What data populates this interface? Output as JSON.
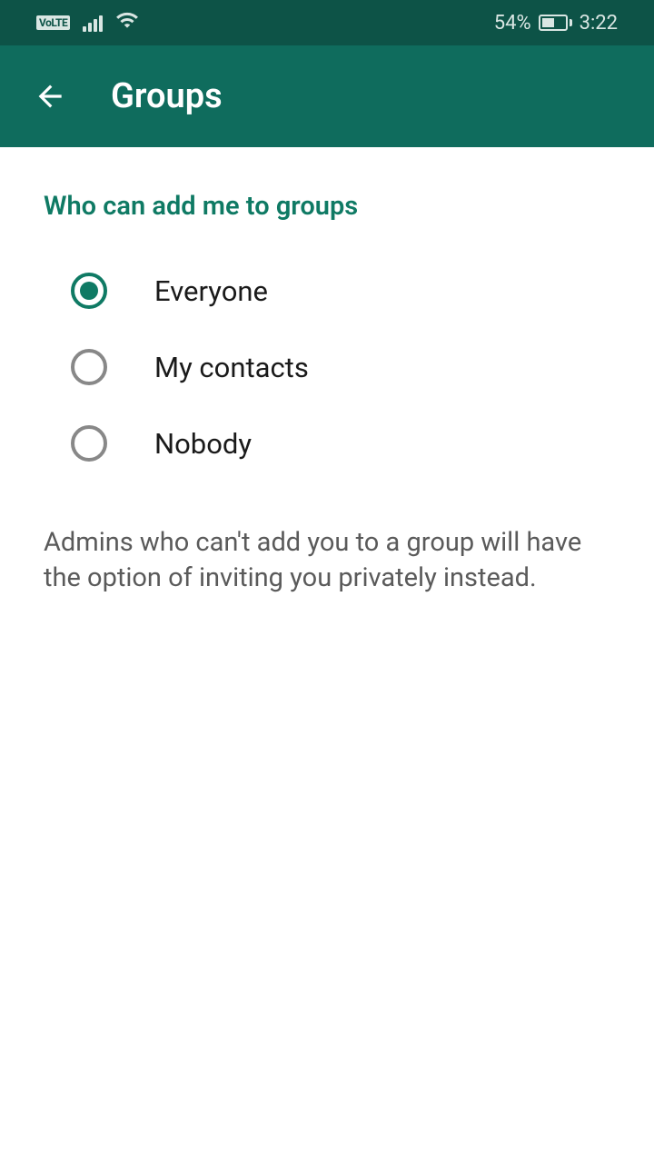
{
  "status_bar": {
    "volte": "VoLTE",
    "battery_percent": "54%",
    "time": "3:22"
  },
  "app_bar": {
    "title": "Groups"
  },
  "section": {
    "title": "Who can add me to groups"
  },
  "options": [
    {
      "label": "Everyone",
      "selected": true
    },
    {
      "label": "My contacts",
      "selected": false
    },
    {
      "label": "Nobody",
      "selected": false
    }
  ],
  "description": "Admins who can't add you to a group will have the option of inviting you privately instead."
}
